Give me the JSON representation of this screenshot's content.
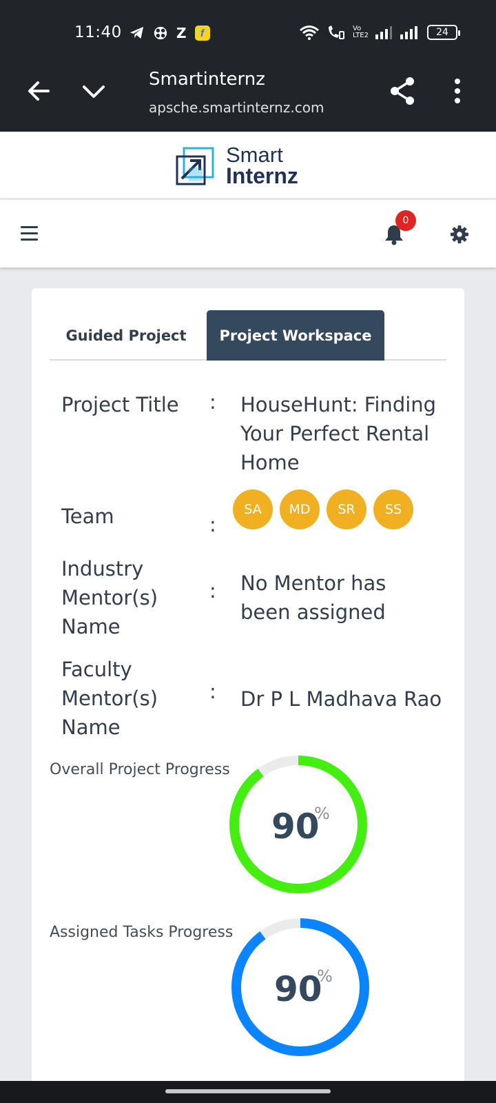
{
  "status_bar": {
    "time": "11:40",
    "notification_icons": [
      "telegram-icon",
      "pinwheel-icon",
      "zomato-icon",
      "flipkart-icon"
    ],
    "flipkart_glyph": "f",
    "z_glyph": "Z",
    "volte_label": "Vo LTE2",
    "battery": "24"
  },
  "browser": {
    "title": "Smartinternz",
    "url": "apsche.smartinternz.com"
  },
  "logo": {
    "line1": "Smart",
    "line2": "Internz"
  },
  "toolbar": {
    "notification_count": "0"
  },
  "tabs": [
    {
      "label": "Guided Project",
      "active": false
    },
    {
      "label": "Project Workspace",
      "active": true
    }
  ],
  "details": {
    "colon": ":",
    "project_title_label": "Project Title",
    "project_title_line1": "HouseHunt: Finding",
    "project_title_line2": "Your Perfect Rental",
    "project_title_line3": "Home",
    "team_label": "Team",
    "team": [
      "SA",
      "MD",
      "SR",
      "SS"
    ],
    "industry_label_line1": "Industry",
    "industry_label_line2": "Mentor(s)",
    "industry_label_line3": "Name",
    "industry_value_line1": "No Mentor has",
    "industry_value_line2": "been assigned",
    "faculty_label_line1": "Faculty",
    "faculty_label_line2": "Mentor(s)",
    "faculty_label_line3": "Name",
    "faculty_value": "Dr P L Madhava Rao"
  },
  "progress": {
    "overall": {
      "label": "Overall Project Progress",
      "value": "90",
      "unit": "%",
      "fraction": 0.9,
      "color": "#44ee11"
    },
    "assigned": {
      "label": "Assigned Tasks Progress",
      "value": "90",
      "unit": "%",
      "fraction": 0.9,
      "color": "#0b84ff"
    }
  },
  "colors": {
    "header_bg": "#212428",
    "tab_active_bg": "#34495e",
    "avatar_bg": "#f0b022",
    "badge_bg": "#e02424",
    "gauge_track": "#ebebeb"
  }
}
